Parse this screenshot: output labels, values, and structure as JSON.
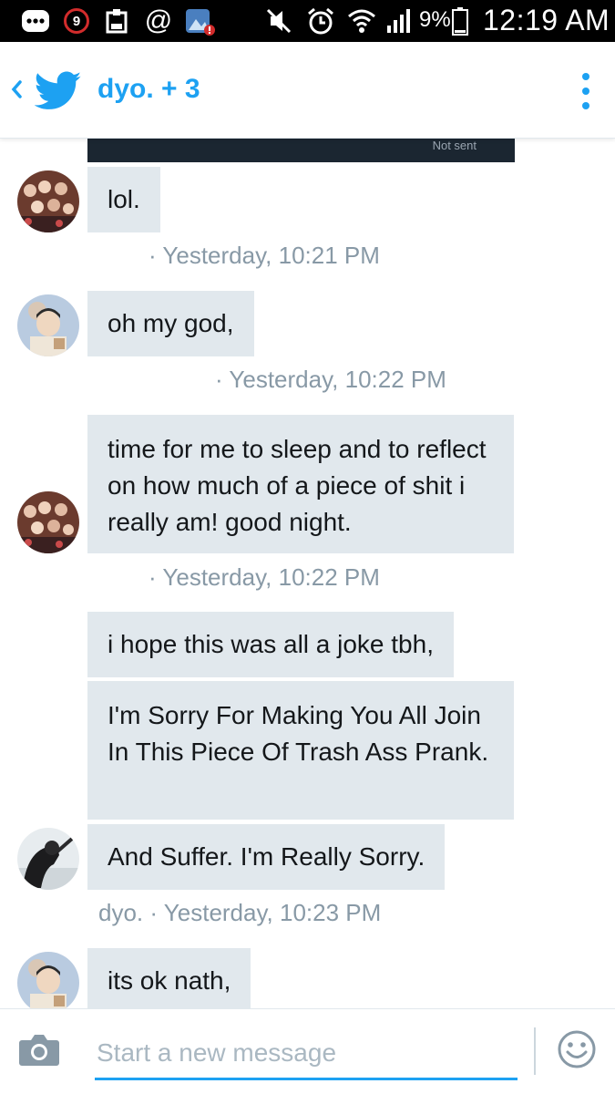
{
  "status_bar": {
    "notification_count": "9",
    "battery_percent": "9%",
    "time": "12:19 AM",
    "icons": [
      "chat-bubble-icon",
      "notification-badge-icon",
      "clipboard-icon",
      "at-sign-icon",
      "image-alert-icon",
      "mute-icon",
      "alarm-icon",
      "wifi-icon",
      "signal-icon",
      "battery-icon"
    ]
  },
  "header": {
    "back_icon": "chevron-left-icon",
    "logo_icon": "twitter-bird-icon",
    "title": "dyo. + 3",
    "menu_icon": "overflow-menu-icon"
  },
  "media_card": {
    "status": "Not sent"
  },
  "messages": [
    {
      "text": "lol.",
      "timestamp": "· Yesterday, 10:21 PM",
      "avatar": "avatar-group-photo"
    },
    {
      "text": "oh my god,",
      "timestamp": "· Yesterday, 10:22 PM",
      "avatar": "avatar-person-photo"
    },
    {
      "text": "time for me to sleep and to reflect on how much of a piece of shit i really am! good night.",
      "timestamp": "· Yesterday, 10:22 PM",
      "avatar": "avatar-group-photo"
    },
    {
      "text": "i hope this was all a joke tbh,"
    },
    {
      "text": "I'm Sorry For Making You All Join In This Piece Of Trash Ass Prank."
    },
    {
      "text": "And Suffer. I'm Really Sorry.",
      "sender": "dyo.",
      "timestamp": "· Yesterday, 10:23 PM",
      "avatar": "avatar-dark-photo"
    },
    {
      "text": "its ok nath,",
      "avatar": "avatar-person-photo"
    }
  ],
  "composer": {
    "camera_icon": "camera-icon",
    "placeholder": "Start a new message",
    "value": "",
    "emoji_icon": "emoji-icon"
  },
  "colors": {
    "accent": "#1da1f2",
    "bubble": "#e1e8ed",
    "meta_text": "#8899a6",
    "status_bar": "#000000",
    "badge_ring": "#d22c2c"
  }
}
